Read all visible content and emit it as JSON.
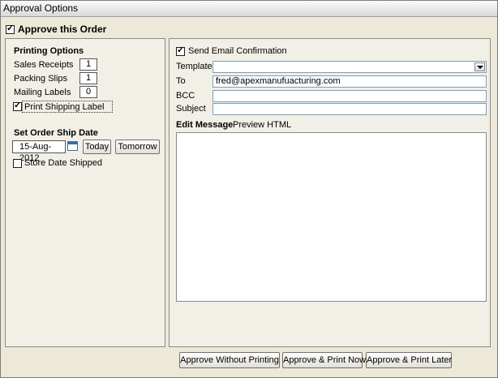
{
  "window": {
    "title": "Approval Options"
  },
  "approve": {
    "label": "Approve this Order",
    "checked": true
  },
  "printing": {
    "heading": "Printing Options",
    "rows": [
      {
        "label": "Sales Receipts",
        "value": "1"
      },
      {
        "label": "Packing Slips",
        "value": "1"
      },
      {
        "label": "Mailing Labels",
        "value": "0"
      }
    ],
    "shipping_label": "Print Shipping Label"
  },
  "ship_date": {
    "heading": "Set Order Ship Date",
    "value": "15-Aug-2012",
    "today": "Today",
    "tomorrow": "Tomorrow",
    "store_label": "Store Date Shipped"
  },
  "email": {
    "send_label": "Send Email Confirmation",
    "template_label": "Template",
    "template_value": "",
    "to_label": "To",
    "to_value": "fred@apexmanufuacturing.com",
    "bcc_label": "BCC",
    "bcc_value": "",
    "subject_label": "Subject",
    "subject_value": "",
    "tab_edit": "Edit Message",
    "tab_preview": "Preview HTML"
  },
  "footer": {
    "btn_without": "Approve Without Printing",
    "btn_print_now": "Approve & Print Now",
    "btn_print_later": "Approve & Print Later"
  }
}
